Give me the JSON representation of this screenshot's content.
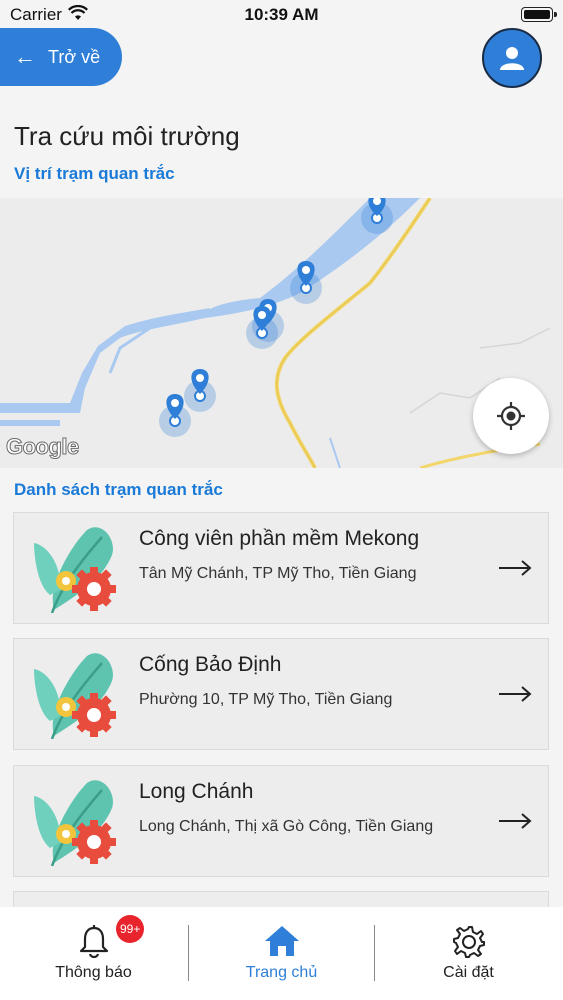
{
  "status_bar": {
    "carrier": "Carrier",
    "time": "10:39 AM"
  },
  "header": {
    "back_label": "Trở về"
  },
  "page": {
    "title": "Tra cứu môi trường",
    "map_section": "Vị trí trạm quan trắc",
    "list_section": "Danh sách trạm quan trắc"
  },
  "map": {
    "logo": "Google",
    "icons": {
      "marker": "map-pin-icon",
      "locate": "crosshair-icon"
    },
    "colors": {
      "water": "#a9c9f0",
      "land": "#ececec",
      "road": "#f3d66a",
      "marker": "#2f7fd8"
    }
  },
  "stations": [
    {
      "name": "Công viên phần mềm Mekong",
      "address": "Tân Mỹ Chánh, TP Mỹ Tho, Tiền Giang"
    },
    {
      "name": "Cống Bảo Định",
      "address": "Phường 10, TP Mỹ Tho, Tiền Giang"
    },
    {
      "name": "Long Chánh",
      "address": "Long Chánh, Thị xã Gò Công, Tiền Giang"
    }
  ],
  "tabs": [
    {
      "label": "Thông báo",
      "icon": "bell-icon",
      "badge": "99+"
    },
    {
      "label": "Trang chủ",
      "icon": "home-icon",
      "active": true
    },
    {
      "label": "Cài đặt",
      "icon": "gear-icon"
    }
  ],
  "colors": {
    "accent": "#2f7fd8",
    "link": "#1a7ad8",
    "badge": "#e8242c"
  }
}
